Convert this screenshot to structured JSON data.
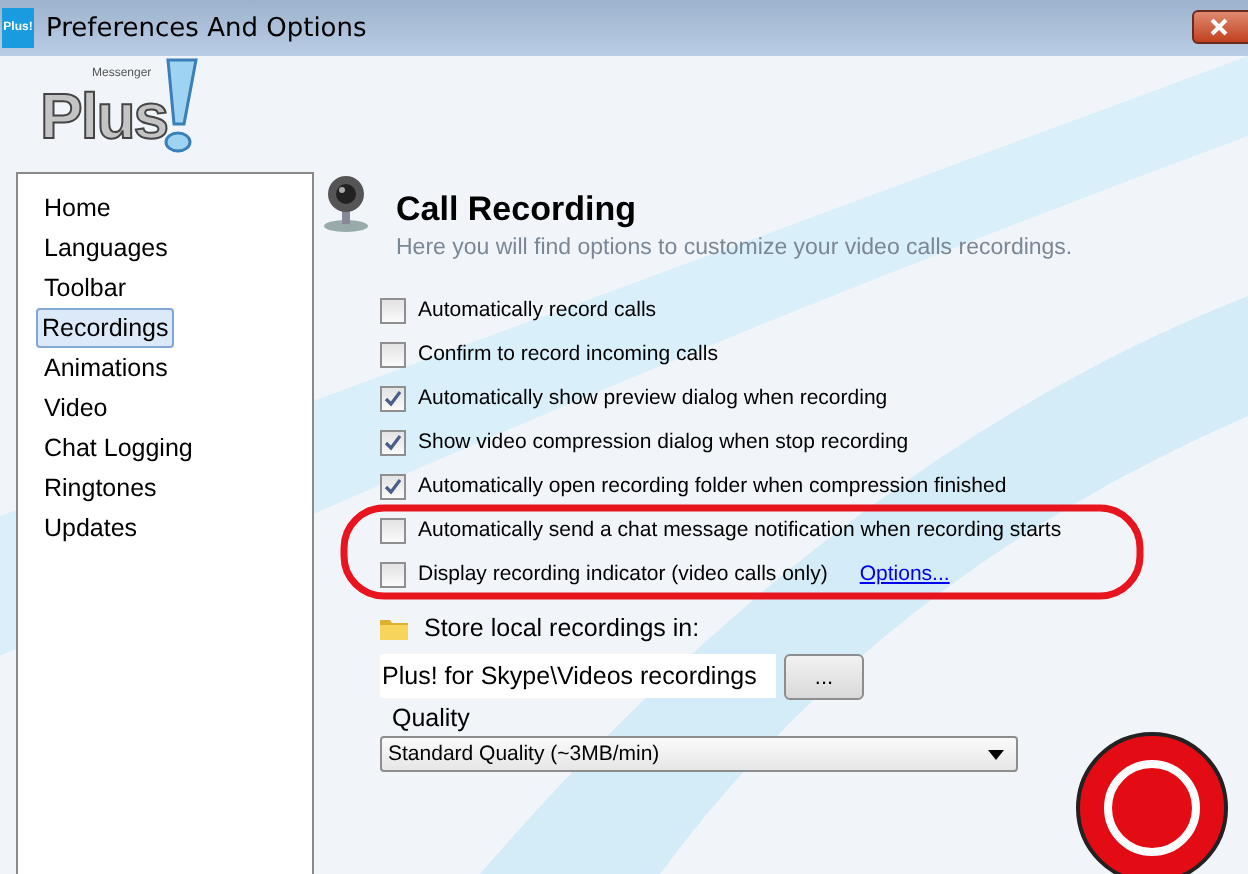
{
  "window": {
    "title": "Preferences And Options",
    "app_icon_text": "Plus!"
  },
  "logo": {
    "small_text": "Messenger",
    "main_text": "Plus"
  },
  "sidebar": {
    "items": [
      {
        "label": "Home",
        "selected": false
      },
      {
        "label": "Languages",
        "selected": false
      },
      {
        "label": "Toolbar",
        "selected": false
      },
      {
        "label": "Recordings",
        "selected": true
      },
      {
        "label": "Animations",
        "selected": false
      },
      {
        "label": "Video",
        "selected": false
      },
      {
        "label": "Chat Logging",
        "selected": false
      },
      {
        "label": "Ringtones",
        "selected": false
      },
      {
        "label": "Updates",
        "selected": false
      }
    ]
  },
  "header": {
    "title": "Call Recording",
    "subtitle": "Here you will find options to customize your video calls recordings."
  },
  "options": [
    {
      "label": "Automatically record calls",
      "checked": false
    },
    {
      "label": "Confirm to record incoming calls",
      "checked": false
    },
    {
      "label": "Automatically show preview dialog when recording",
      "checked": true
    },
    {
      "label": "Show video compression dialog when stop recording",
      "checked": true
    },
    {
      "label": "Automatically open recording folder when compression finished",
      "checked": true
    },
    {
      "label": "Automatically send a chat message notification when recording starts",
      "checked": false,
      "highlighted": true
    },
    {
      "label": "Display recording indicator (video calls only)",
      "checked": false,
      "highlighted": true,
      "link": "Options..."
    }
  ],
  "storage": {
    "label": "Store local recordings in:",
    "path": "Plus! for Skype\\Videos recordings",
    "browse_button": "..."
  },
  "quality": {
    "label": "Quality",
    "value": "Standard Quality (~3MB/min)"
  }
}
